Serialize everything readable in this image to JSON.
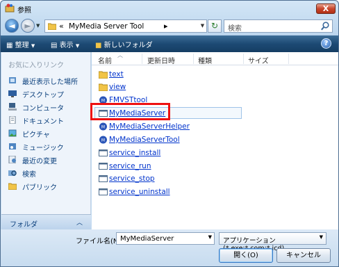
{
  "window": {
    "title": "参照",
    "close_label": "X"
  },
  "address": {
    "back_icon": "back-arrow-icon",
    "forward_icon": "forward-arrow-icon",
    "prefix": "«",
    "path": "MyMedia Server Tool",
    "path_arrow": "▸",
    "refresh_icon": "refresh-icon",
    "search_placeholder": "検索"
  },
  "toolbar": {
    "organize_label": "整理",
    "views_label": "表示",
    "new_folder_label": "新しいフォルダ",
    "help_label": "?"
  },
  "nav": {
    "header": "お気に入りリンク",
    "items": [
      {
        "label": "最近表示した場所",
        "icon": "recent-places-icon"
      },
      {
        "label": "デスクトップ",
        "icon": "desktop-icon"
      },
      {
        "label": "コンピュータ",
        "icon": "computer-icon"
      },
      {
        "label": "ドキュメント",
        "icon": "documents-icon"
      },
      {
        "label": "ピクチャ",
        "icon": "pictures-icon"
      },
      {
        "label": "ミュージック",
        "icon": "music-icon"
      },
      {
        "label": "最近の変更",
        "icon": "recent-changes-icon"
      },
      {
        "label": "検索",
        "icon": "search-folder-icon"
      },
      {
        "label": "パブリック",
        "icon": "public-folder-icon"
      }
    ],
    "folders_label": "フォルダ",
    "folders_chevron": "︿"
  },
  "columns": {
    "name": "名前",
    "modified": "更新日時",
    "type": "種類",
    "size": "サイズ"
  },
  "files": [
    {
      "name": "text",
      "kind": "folder"
    },
    {
      "name": "view",
      "kind": "folder"
    },
    {
      "name": "FMVSTtool",
      "kind": "app"
    },
    {
      "name": "MyMediaServer",
      "kind": "exe"
    },
    {
      "name": "MyMediaServerHelper",
      "kind": "app"
    },
    {
      "name": "MyMediaServerTool",
      "kind": "app"
    },
    {
      "name": "service_install",
      "kind": "exe"
    },
    {
      "name": "service_run",
      "kind": "exe"
    },
    {
      "name": "service_stop",
      "kind": "exe"
    },
    {
      "name": "service_uninstall",
      "kind": "exe"
    }
  ],
  "footer": {
    "filename_label": "ファイル名(N):",
    "filename_value": "MyMediaServer",
    "filetype_value": "アプリケーション (*.exe;*.com;*.icd)",
    "open_label": "開く(O)",
    "cancel_label": "キャンセル"
  },
  "colors": {
    "accent": "#1d4a74",
    "highlight": "#ee1111",
    "link": "#0033cc"
  }
}
